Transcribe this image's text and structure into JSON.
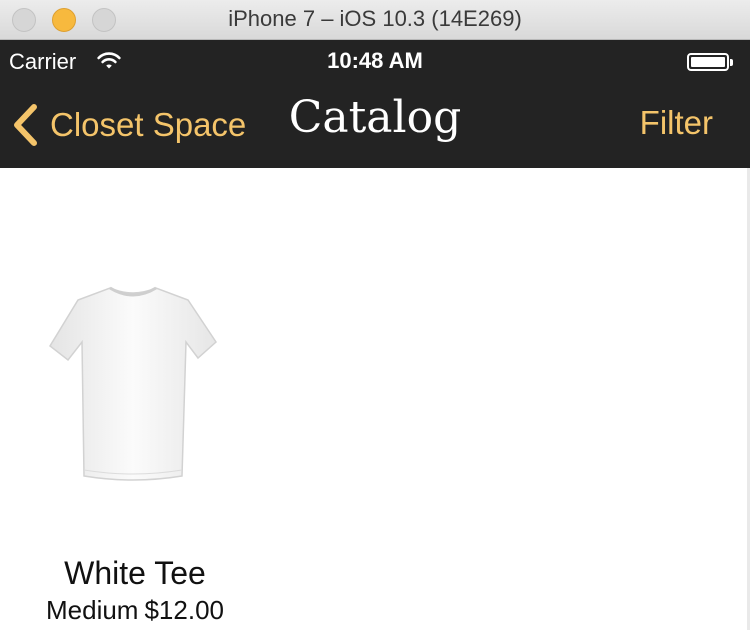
{
  "window": {
    "title": "iPhone 7 – iOS 10.3 (14E269)"
  },
  "status_bar": {
    "carrier": "Carrier",
    "time": "10:48 AM",
    "wifi_icon": "wifi-icon",
    "battery_icon": "battery-icon",
    "battery_level": 1.0
  },
  "nav_bar": {
    "back_label": "Closet Space",
    "back_icon": "chevron-left-icon",
    "title": "Catalog",
    "right_button": "Filter"
  },
  "colors": {
    "nav_background": "#232323",
    "accent": "#f4c46a",
    "title_text": "#ffffff",
    "content_background": "#ffffff"
  },
  "catalog": {
    "items": [
      {
        "name": "White Tee",
        "size": "Medium",
        "price": "$12.00",
        "image": "white-tshirt-image"
      }
    ]
  }
}
